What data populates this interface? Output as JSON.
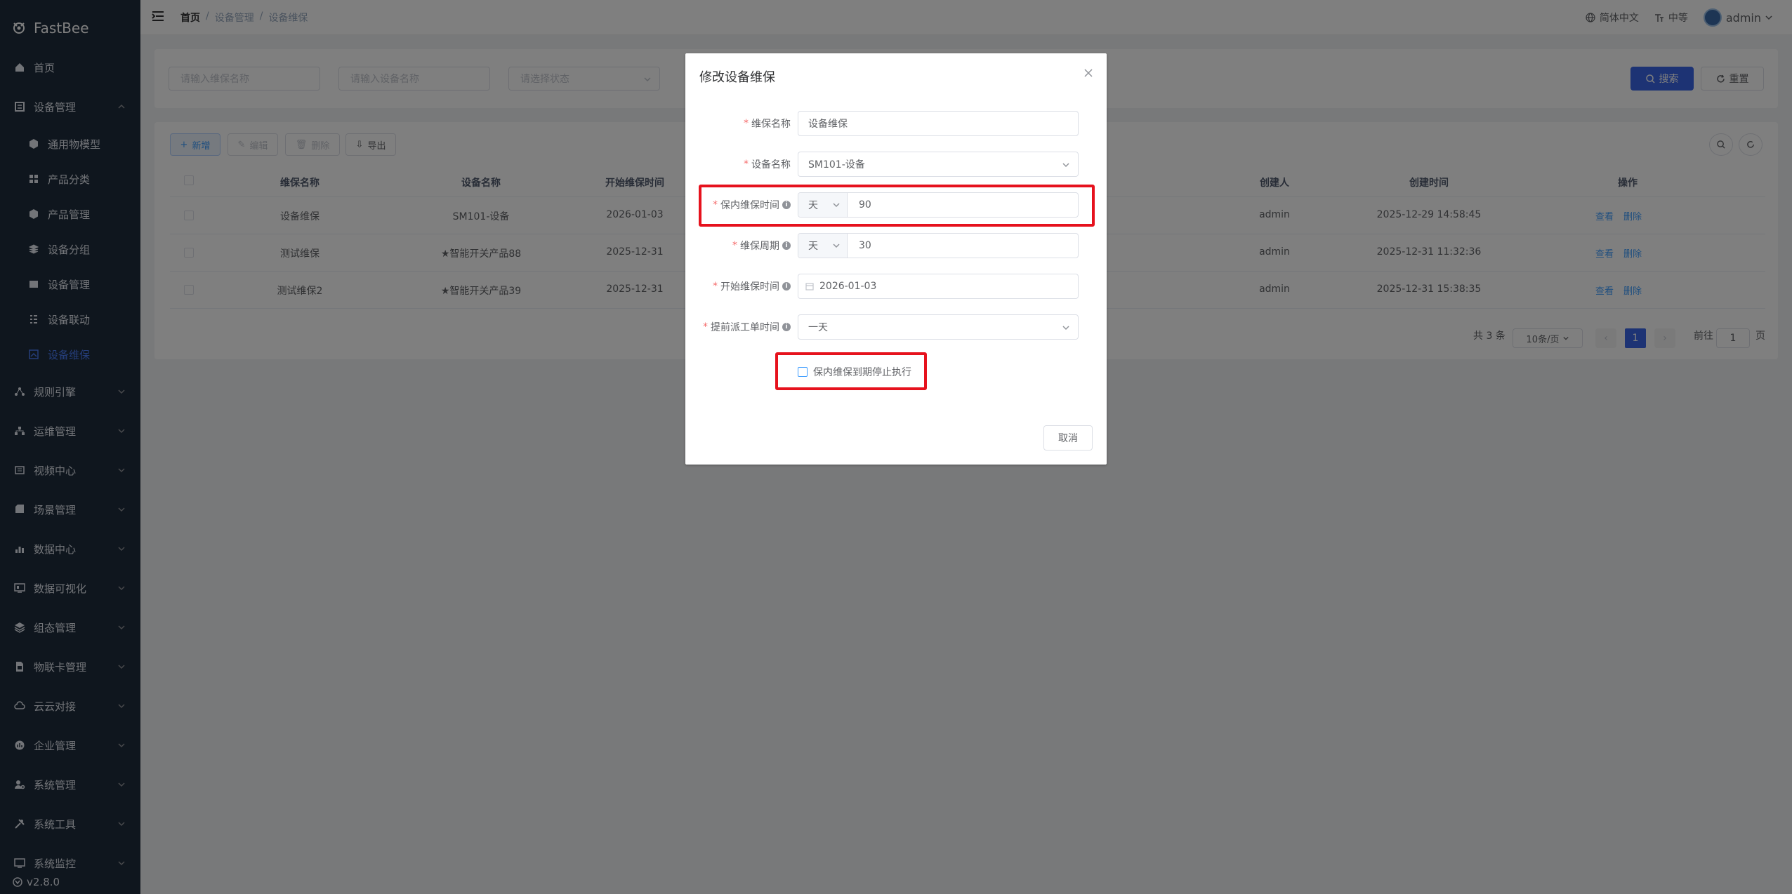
{
  "app": {
    "name": "FastBee",
    "version": "v2.8.0"
  },
  "sidebar": {
    "items": [
      {
        "label": "首页",
        "icon": "home-icon"
      },
      {
        "label": "设备管理",
        "icon": "device-icon",
        "expanded": true,
        "children": [
          {
            "label": "通用物模型"
          },
          {
            "label": "产品分类"
          },
          {
            "label": "产品管理"
          },
          {
            "label": "设备分组"
          },
          {
            "label": "设备管理"
          },
          {
            "label": "设备联动"
          },
          {
            "label": "设备维保",
            "active": true
          }
        ]
      },
      {
        "label": "规则引擎"
      },
      {
        "label": "运维管理"
      },
      {
        "label": "视频中心"
      },
      {
        "label": "场景管理"
      },
      {
        "label": "数据中心"
      },
      {
        "label": "数据可视化"
      },
      {
        "label": "组态管理"
      },
      {
        "label": "物联卡管理"
      },
      {
        "label": "云云对接"
      },
      {
        "label": "企业管理"
      },
      {
        "label": "系统管理"
      },
      {
        "label": "系统工具"
      },
      {
        "label": "系统监控"
      }
    ]
  },
  "header": {
    "breadcrumb": [
      "首页",
      "设备管理",
      "设备维保"
    ],
    "language": "简体中文",
    "size": "中等",
    "user": "admin"
  },
  "search": {
    "name_placeholder": "请输入维保名称",
    "device_placeholder": "请输入设备名称",
    "status_placeholder": "请选择状态",
    "search_label": "搜索",
    "reset_label": "重置"
  },
  "toolbar": {
    "add": "新增",
    "edit": "编辑",
    "delete": "删除",
    "export": "导出"
  },
  "table": {
    "columns": [
      "维保名称",
      "设备名称",
      "开始维保时间",
      "创建人",
      "创建时间",
      "操作"
    ],
    "rows": [
      {
        "name": "设备维保",
        "device": "SM101-设备",
        "start": "2026-01-03",
        "creator": "admin",
        "created": "2025-12-29 14:58:45"
      },
      {
        "name": "测试维保",
        "device": "★智能开关产品88",
        "start": "2025-12-31",
        "creator": "admin",
        "created": "2025-12-31 11:32:36"
      },
      {
        "name": "测试维保2",
        "device": "★智能开关产品39",
        "start": "2025-12-31",
        "creator": "admin",
        "created": "2025-12-31 15:38:35"
      }
    ],
    "view_label": "查看",
    "delete_label": "删除"
  },
  "pagination": {
    "total": "共 3 条",
    "page_size": "10条/页",
    "current": "1",
    "goto_label": "前往",
    "goto_value": "1",
    "page_suffix": "页"
  },
  "dialog": {
    "title": "修改设备维保",
    "fields": {
      "maintenance_name": {
        "label": "维保名称",
        "value": "设备维保"
      },
      "device_name": {
        "label": "设备名称",
        "value": "SM101-设备"
      },
      "warranty_time": {
        "label": "保内维保时间",
        "unit": "天",
        "value": "90"
      },
      "cycle": {
        "label": "维保周期",
        "unit": "天",
        "value": "30"
      },
      "start_time": {
        "label": "开始维保时间",
        "value": "2026-01-03"
      },
      "advance_time": {
        "label": "提前派工单时间",
        "value": "一天"
      }
    },
    "checkbox_label": "保内维保到期停止执行",
    "cancel_label": "取消"
  },
  "colors": {
    "sidebar_bg": "#1f2d3d",
    "primary": "#3a66e8",
    "highlight": "#e6121d",
    "active_menu": "#4a7cf6"
  }
}
